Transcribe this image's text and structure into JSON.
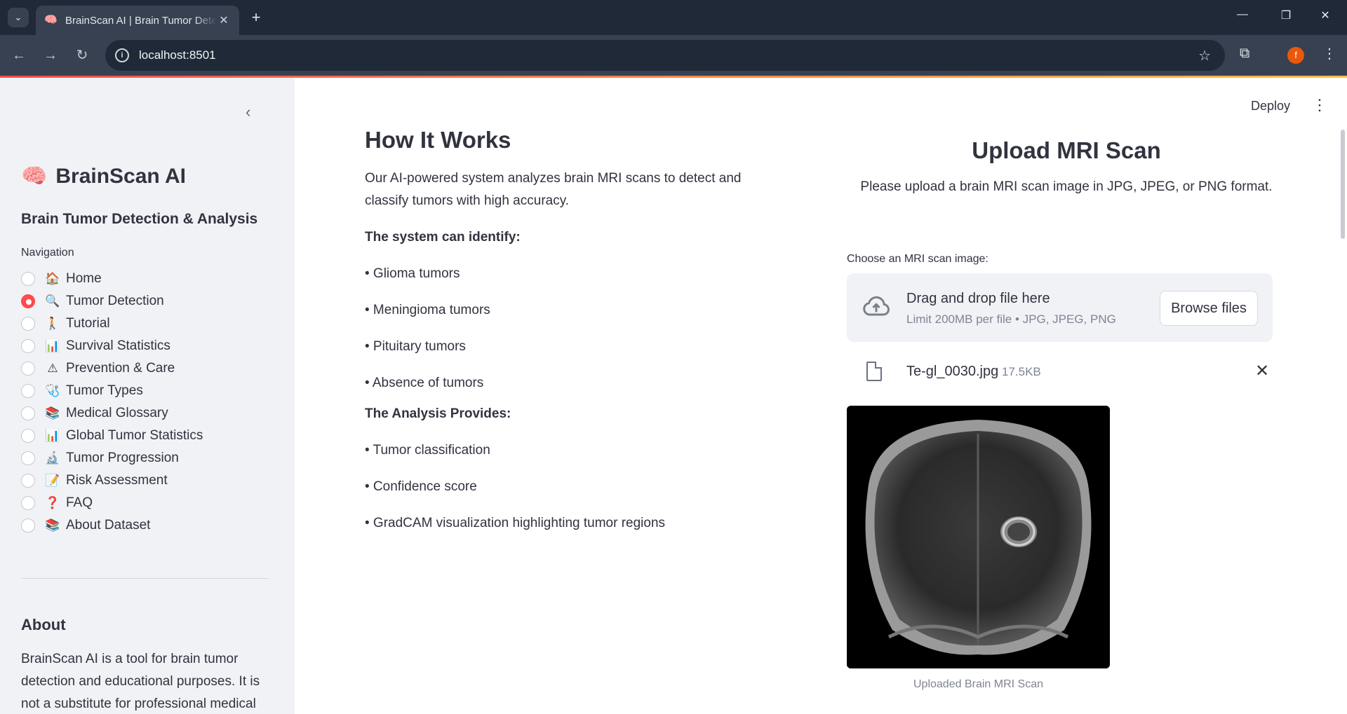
{
  "browser": {
    "tab_title": "BrainScan AI | Brain Tumor Detection",
    "url": "localhost:8501",
    "avatar_letter": "f"
  },
  "sidebar": {
    "brand": "BrainScan AI",
    "subtitle": "Brain Tumor Detection & Analysis",
    "nav_label": "Navigation",
    "items": [
      {
        "label": "Home",
        "icon": "🏠",
        "selected": false
      },
      {
        "label": "Tumor Detection",
        "icon": "🔍",
        "selected": true
      },
      {
        "label": "Tutorial",
        "icon": "🚶",
        "selected": false
      },
      {
        "label": "Survival Statistics",
        "icon": "📊",
        "selected": false
      },
      {
        "label": "Prevention & Care",
        "icon": "⚠",
        "selected": false
      },
      {
        "label": "Tumor Types",
        "icon": "🩺",
        "selected": false
      },
      {
        "label": "Medical Glossary",
        "icon": "📚",
        "selected": false
      },
      {
        "label": "Global Tumor Statistics",
        "icon": "📊",
        "selected": false
      },
      {
        "label": "Tumor Progression",
        "icon": "🔬",
        "selected": false
      },
      {
        "label": "Risk Assessment",
        "icon": "📝",
        "selected": false
      },
      {
        "label": "FAQ",
        "icon": "❓",
        "selected": false
      },
      {
        "label": "About Dataset",
        "icon": "📚",
        "selected": false
      }
    ],
    "about_heading": "About",
    "about_text": "BrainScan AI is a tool for brain tumor detection and educational purposes. It is not a substitute for professional medical"
  },
  "header": {
    "deploy_label": "Deploy"
  },
  "how": {
    "title": "How It Works",
    "intro": "Our AI-powered system analyzes brain MRI scans to detect and classify tumors with high accuracy.",
    "identify_heading": "The system can identify:",
    "identify_items": [
      "• Glioma tumors",
      "• Meningioma tumors",
      "• Pituitary tumors",
      "• Absence of tumors"
    ],
    "provides_heading": "The Analysis Provides:",
    "provides_items": [
      "• Tumor classification",
      "• Confidence score",
      "• GradCAM visualization highlighting tumor regions"
    ]
  },
  "upload": {
    "title": "Upload MRI Scan",
    "description": "Please upload a brain MRI scan image in JPG, JPEG, or PNG format.",
    "label": "Choose an MRI scan image:",
    "drop_text": "Drag and drop file here",
    "limit_text": "Limit 200MB per file • JPG, JPEG, PNG",
    "browse_label": "Browse files",
    "file_name": "Te-gl_0030.jpg",
    "file_size": "17.5KB",
    "caption": "Uploaded Brain MRI Scan"
  }
}
